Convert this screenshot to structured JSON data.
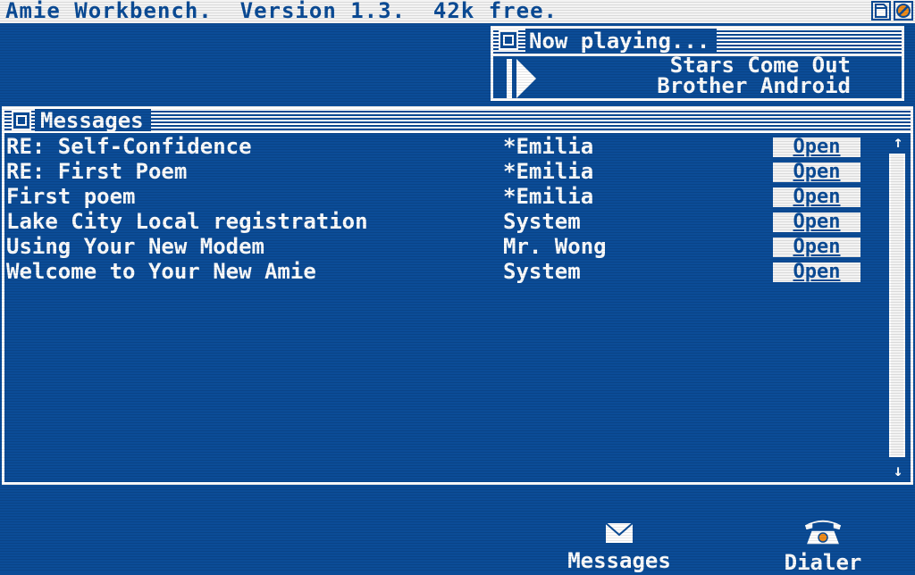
{
  "menubar": {
    "title": "Amie Workbench.  Version 1.3.  42k free.",
    "icons": [
      "document-icon",
      "no-entry-icon"
    ]
  },
  "now_playing": {
    "window_title": "Now playing...",
    "track": "Stars Come Out",
    "artist": "Brother Android",
    "play_icon": "play-icon"
  },
  "messages_window": {
    "title": "Messages",
    "open_label": "Open",
    "rows": [
      {
        "subject": "RE: Self-Confidence",
        "sender": "*Emilia"
      },
      {
        "subject": "RE: First Poem",
        "sender": "*Emilia"
      },
      {
        "subject": "First poem",
        "sender": "*Emilia"
      },
      {
        "subject": "Lake City Local registration",
        "sender": "System"
      },
      {
        "subject": "Using Your New Modem",
        "sender": "Mr. Wong"
      },
      {
        "subject": "Welcome to Your New Amie",
        "sender": "System"
      }
    ]
  },
  "desktop": {
    "messages_label": "Messages",
    "dialer_label": "Dialer"
  },
  "colors": {
    "background": "#0b4c97",
    "foreground": "#ffffff",
    "accent": "#f08c1a"
  }
}
